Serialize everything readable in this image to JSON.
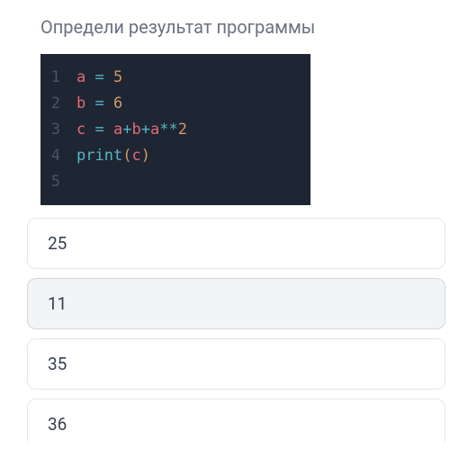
{
  "question": {
    "title": "Определи результат программы"
  },
  "code": {
    "lines": [
      {
        "num": "1",
        "tokens": [
          {
            "t": "a",
            "c": "var"
          },
          {
            "t": " = ",
            "c": "op"
          },
          {
            "t": "5",
            "c": "num"
          }
        ]
      },
      {
        "num": "2",
        "tokens": [
          {
            "t": "b",
            "c": "var"
          },
          {
            "t": " = ",
            "c": "op"
          },
          {
            "t": "6",
            "c": "num"
          }
        ]
      },
      {
        "num": "3",
        "tokens": [
          {
            "t": "c",
            "c": "var"
          },
          {
            "t": " = ",
            "c": "op"
          },
          {
            "t": "a",
            "c": "var"
          },
          {
            "t": "+",
            "c": "op"
          },
          {
            "t": "b",
            "c": "var"
          },
          {
            "t": "+",
            "c": "op"
          },
          {
            "t": "a",
            "c": "var"
          },
          {
            "t": "**",
            "c": "op"
          },
          {
            "t": "2",
            "c": "num"
          }
        ]
      },
      {
        "num": "4",
        "tokens": [
          {
            "t": "print",
            "c": "func"
          },
          {
            "t": "(",
            "c": "paren"
          },
          {
            "t": "c",
            "c": "param"
          },
          {
            "t": ")",
            "c": "paren"
          }
        ]
      },
      {
        "num": "5",
        "tokens": []
      }
    ]
  },
  "options": [
    {
      "label": "25",
      "selected": false
    },
    {
      "label": "11",
      "selected": true
    },
    {
      "label": "35",
      "selected": false
    },
    {
      "label": "36",
      "selected": false
    }
  ]
}
